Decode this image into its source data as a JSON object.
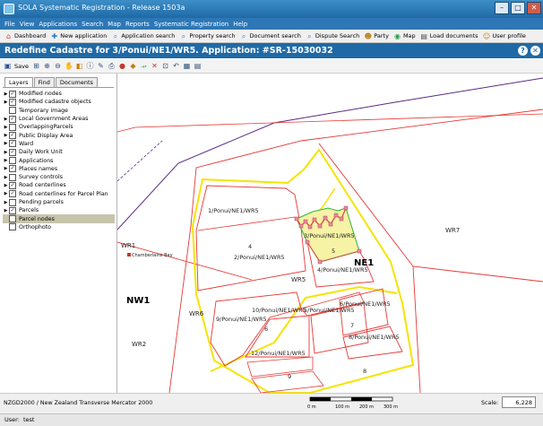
{
  "window": {
    "title": "SOLA Systematic Registration - Release 1503a"
  },
  "menu": [
    "File",
    "View",
    "Applications",
    "Search",
    "Map",
    "Reports",
    "Systematic Registration",
    "Help"
  ],
  "toolbar": [
    {
      "label": "Dashboard",
      "icon": "dashboard-icon"
    },
    {
      "label": "New application",
      "icon": "new-application-icon"
    },
    {
      "label": "Application search",
      "icon": "application-search-icon"
    },
    {
      "label": "Property search",
      "icon": "property-search-icon"
    },
    {
      "label": "Document search",
      "icon": "document-search-icon"
    },
    {
      "label": "Dispute Search",
      "icon": "dispute-search-icon"
    },
    {
      "label": "Party",
      "icon": "party-icon"
    },
    {
      "label": "Map",
      "icon": "map-icon"
    },
    {
      "label": "Load documents",
      "icon": "load-documents-icon"
    },
    {
      "label": "User profile",
      "icon": "user-profile-icon"
    }
  ],
  "header": {
    "title": "Redefine Cadastre for 3/Ponui/NE1/WR5. Application: #SR-15030032"
  },
  "map_toolbar": {
    "save_label": "Save"
  },
  "tabs": [
    "Layers",
    "Find",
    "Documents"
  ],
  "layers": [
    {
      "label": "Modified nodes",
      "checked": true,
      "expandable": true
    },
    {
      "label": "Modified cadastre objects",
      "checked": true,
      "expandable": true
    },
    {
      "label": "Temporary image",
      "checked": false,
      "expandable": false
    },
    {
      "label": "Local Government Areas",
      "checked": true,
      "expandable": true
    },
    {
      "label": "OverlappingParcels",
      "checked": false,
      "expandable": true
    },
    {
      "label": "Public Display Area",
      "checked": true,
      "expandable": true
    },
    {
      "label": "Ward",
      "checked": true,
      "expandable": true
    },
    {
      "label": "Daily Work Unit",
      "checked": true,
      "expandable": true
    },
    {
      "label": "Applications",
      "checked": false,
      "expandable": true
    },
    {
      "label": "Places names",
      "checked": true,
      "expandable": true
    },
    {
      "label": "Survey controls",
      "checked": false,
      "expandable": true
    },
    {
      "label": "Road centerlines",
      "checked": true,
      "expandable": true
    },
    {
      "label": "Road centerlines for Parcel Plan",
      "checked": true,
      "expandable": true
    },
    {
      "label": "Pending parcels",
      "checked": false,
      "expandable": true
    },
    {
      "label": "Parcels",
      "checked": true,
      "expandable": true
    },
    {
      "label": "Parcel nodes",
      "checked": false,
      "expandable": false,
      "selected": true
    },
    {
      "label": "Orthophoto",
      "checked": false,
      "expandable": false
    }
  ],
  "map": {
    "labels": {
      "wr1": "WR1",
      "chamberlains_bay": "Chamberlains Bay",
      "nw1": "NW1",
      "wr6": "WR6",
      "wr2": "WR2",
      "wr7": "WR7",
      "ne1": "NE1",
      "wr5": "WR5",
      "p1": "1/Ponui/NE1/WR5",
      "p4num": "4",
      "p2": "2/Ponui/NE1/WR5",
      "p3": "3/Ponui/NE1/WR5",
      "p5num": "5",
      "p4": "4/Ponui/NE1/WR5",
      "p9": "9/Ponui/NE1/WR5",
      "p10": "10/Ponui/NE1/WR5",
      "p5b": "5/Ponui/NE1/WR5",
      "p6": "6/Ponui/NE1/WR5",
      "p6num": "6",
      "p7num": "7",
      "p8": "8/Ponui/NE1/WR5",
      "p12": "12/Ponui/NE1/WR5",
      "p9num": "9",
      "p8num": "8"
    }
  },
  "scalebar": {
    "ticks": [
      "0 m",
      "100 m",
      "200 m",
      "300 m"
    ]
  },
  "status": {
    "crs": "NZGD2000 / New Zealand Transverse Mercator 2000",
    "scale_label": "Scale:",
    "scale_value": "6,228"
  },
  "user": {
    "label": "User:",
    "name": "test"
  },
  "colors": {
    "header": "#1f6aa6",
    "parcel_line": "#e53935",
    "road_line": "#f5e400",
    "ward_line": "#5b2a86",
    "edit_fill": "#f6f2a6",
    "edit_outline": "#2eb82e",
    "selected_layer": "#c8c4ac"
  }
}
